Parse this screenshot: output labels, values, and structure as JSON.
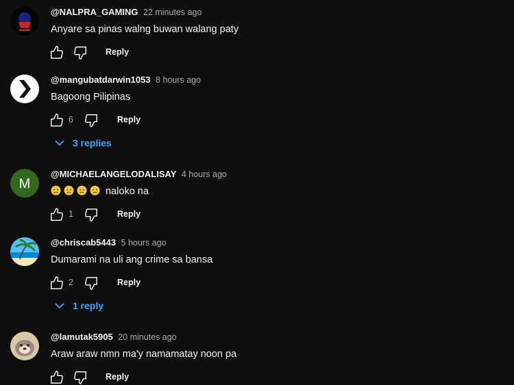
{
  "comments": [
    {
      "author": "@NALPRA_GAMING",
      "time": "22 minutes ago",
      "text": "Anyare sa pinas walng buwan walang paty",
      "likes": "",
      "reply_label": "Reply",
      "avatar": "gaming-logo"
    },
    {
      "author": "@mangubatdarwin1053",
      "time": "8 hours ago",
      "text": "Bagoong Pilipinas",
      "likes": "6",
      "reply_label": "Reply",
      "avatar": "chevron-logo",
      "replies_label": "3 replies"
    },
    {
      "author": "@MICHAELANGELODALISAY",
      "time": "4 hours ago",
      "text": "naloko na",
      "emojis": [
        "worried-face",
        "worried-face",
        "worried-face",
        "worried-face"
      ],
      "likes": "1",
      "reply_label": "Reply",
      "avatar": "letter",
      "avatar_letter": "M",
      "avatar_color": "#33691e"
    },
    {
      "author": "@chriscab5443",
      "time": "5 hours ago",
      "text": "Dumarami na uli ang crime sa bansa",
      "likes": "2",
      "reply_label": "Reply",
      "avatar": "beach-palm",
      "replies_label": "1 reply"
    },
    {
      "author": "@lamutak5905",
      "time": "20 minutes ago",
      "text": "Araw araw nmn ma'y namamatay noon pa",
      "likes": "",
      "reply_label": "Reply",
      "avatar": "dog-photo"
    }
  ],
  "colors": {
    "background": "#0f0f0f",
    "text": "#f1f1f1",
    "secondary_text": "#aaaaaa",
    "link": "#3ea6ff"
  }
}
